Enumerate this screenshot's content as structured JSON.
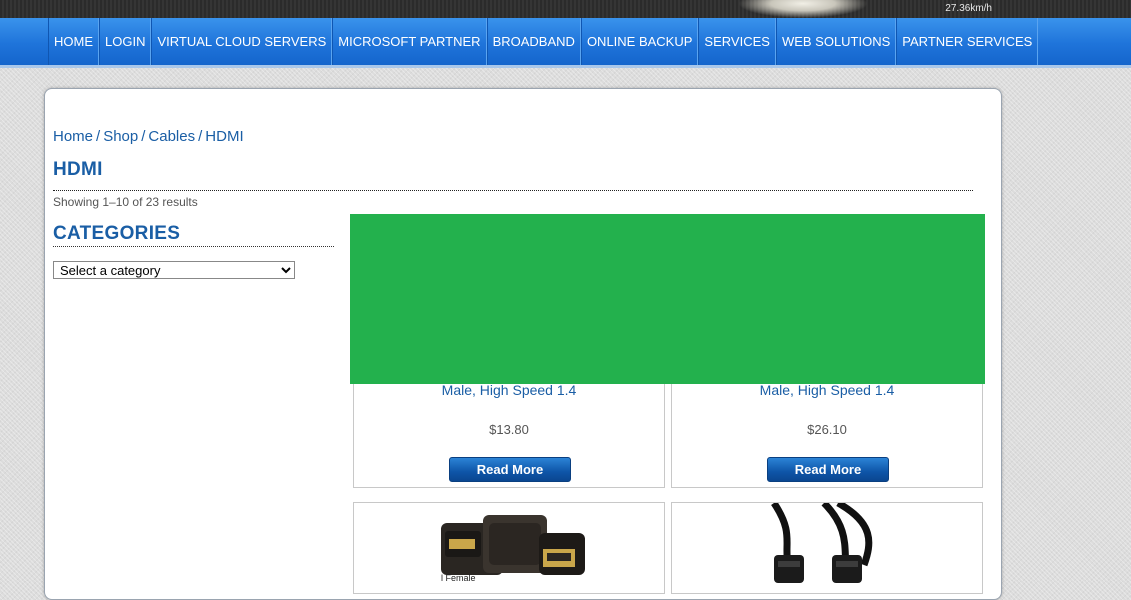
{
  "header": {
    "speed": "27.36km/h",
    "nav": [
      "HOME",
      "LOGIN",
      "VIRTUAL CLOUD SERVERS",
      "MICROSOFT PARTNER",
      "BROADBAND",
      "ONLINE BACKUP",
      "SERVICES",
      "WEB SOLUTIONS",
      "PARTNER SERVICES"
    ]
  },
  "breadcrumb": [
    "Home",
    "Shop",
    "Cables",
    "HDMI"
  ],
  "page": {
    "title": "HDMI",
    "result_count": "Showing 1–10 of 23 results"
  },
  "sidebar": {
    "title": "CATEGORIES",
    "select_value": "Select a category"
  },
  "products": [
    {
      "name": "Male, High Speed 1.4",
      "price": "$13.80",
      "button": "Read More"
    },
    {
      "name": "Male, High Speed 1.4",
      "price": "$26.10",
      "button": "Read More"
    }
  ],
  "thumbnails": [
    {
      "icon": "hdmi-adapter-image",
      "caption": "l Female"
    },
    {
      "icon": "hdmi-cable-image"
    }
  ],
  "colors": {
    "accent": "#1a5ea5",
    "nav": "#1f74da",
    "overlay": "#23b14d"
  }
}
